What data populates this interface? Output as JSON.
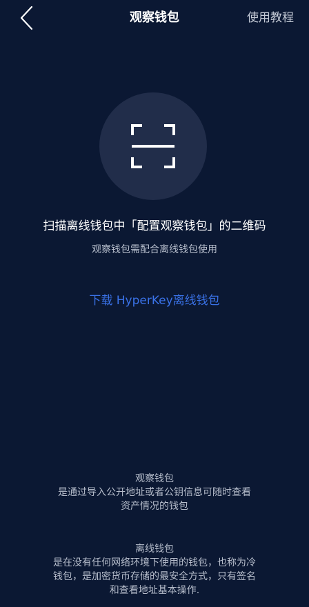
{
  "header": {
    "title": "观察钱包",
    "help_label": "使用教程"
  },
  "scan": {
    "icon": "scan-qr-icon",
    "headline": "扫描离线钱包中「配置观察钱包」的二维码",
    "subline": "观察钱包需配合离线钱包使用"
  },
  "download": {
    "label": "下载 HyperKey离线钱包"
  },
  "info": {
    "watch_wallet": {
      "title": "观察钱包",
      "lines": [
        "是通过导入公开地址或者公钥信息可随时查看",
        "资产情况的钱包"
      ]
    },
    "cold_wallet": {
      "title": "离线钱包",
      "lines": [
        "是在没有任何网络环境下使用的钱包，也称为冷",
        "钱包，是加密货币存储的最安全方式，只有签名",
        "和查看地址基本操作."
      ]
    }
  },
  "colors": {
    "background": "#0b1833",
    "scan_circle": "#212d4a",
    "link": "#3a72e8",
    "muted_text": "#b6bdcb"
  }
}
